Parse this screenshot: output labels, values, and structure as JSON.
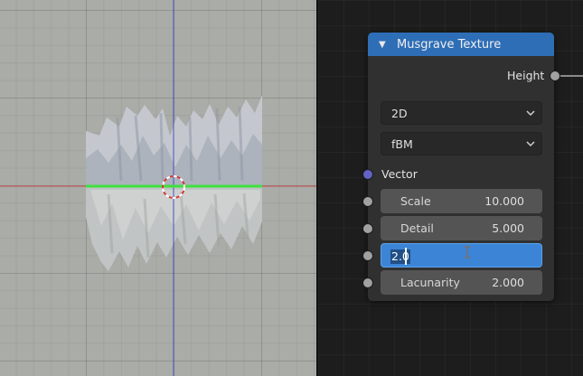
{
  "node": {
    "title": "Musgrave Texture",
    "output_label": "Height",
    "dimensions": "2D",
    "musgrave_type": "fBM",
    "vector_label": "Vector",
    "inputs": [
      {
        "label": "Scale",
        "value": "10.000"
      },
      {
        "label": "Detail",
        "value": "5.000"
      },
      {
        "label": "",
        "value": "2.0",
        "editing": true
      },
      {
        "label": "Lacunarity",
        "value": "2.000"
      }
    ]
  },
  "colors": {
    "header": "#2e6eb6",
    "editing_field": "#3c85d6",
    "vector_socket": "#6363c7",
    "value_socket": "#a1a1a1",
    "x_axis": "#c84b4b",
    "y_axis_view": "#4b50c8",
    "selection_edge": "#3fe13f"
  },
  "icons": {
    "collapse": "triangle-down-icon",
    "dropdown": "chevron-down-icon",
    "cursor": "3d-cursor-icon",
    "mouse": "text-cursor-icon"
  }
}
